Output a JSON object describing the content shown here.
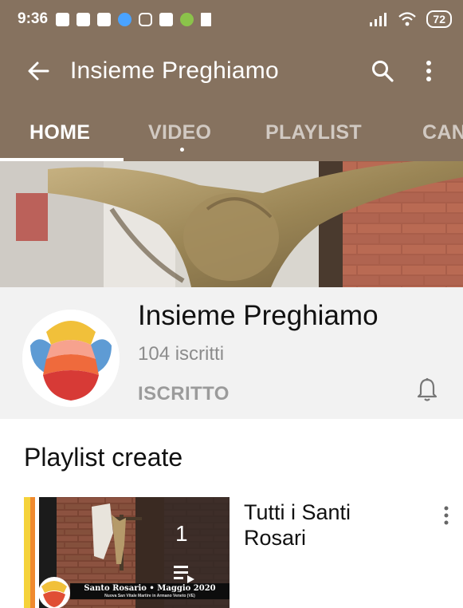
{
  "status_bar": {
    "time": "9:36",
    "battery": "72",
    "icons": [
      "facebook-icon",
      "facebook-icon",
      "youtube-icon",
      "browser-icon",
      "instagram-icon",
      "gmail-icon",
      "app-icon",
      "trash-icon"
    ]
  },
  "app_bar": {
    "title": "Insieme Preghiamo",
    "back_icon": "arrow-left-icon",
    "search_icon": "search-icon",
    "menu_icon": "more-vert-icon"
  },
  "tabs": [
    {
      "label": "HOME",
      "active": true
    },
    {
      "label": "VIDEO",
      "active": false
    },
    {
      "label": "PLAYLIST",
      "active": false
    },
    {
      "label": "CANALI",
      "active": false
    }
  ],
  "channel": {
    "name": "Insieme Preghiamo",
    "subscribers": "104 iscritti",
    "subscribed_label": "ISCRITTO",
    "bell_icon": "bell-icon"
  },
  "section": {
    "title": "Playlist create"
  },
  "playlists": [
    {
      "title": "Tutti i Santi Rosari",
      "count": "1",
      "thumbnail_caption": "Santo Rosario • Maggio 2020",
      "thumbnail_subcaption": "Nuova San Vitale Martire in Armano Veneto (VE)"
    }
  ],
  "colors": {
    "header": "#86725f",
    "channel_bg": "#f2f2f2",
    "text_muted": "#8c8c8c"
  }
}
